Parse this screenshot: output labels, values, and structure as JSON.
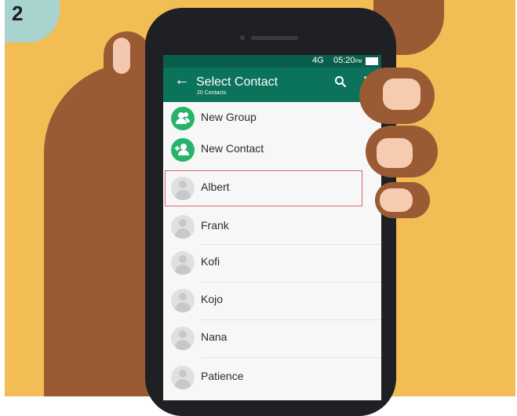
{
  "step_badge": "2",
  "status_bar": {
    "network": "4G",
    "time": "05:20",
    "time_suffix": "PM"
  },
  "app_bar": {
    "title": "Select Contact",
    "subtitle": "20 Contacts",
    "back_icon": "back-arrow-icon",
    "search_icon": "search-icon",
    "more_icon": "more-vert-icon"
  },
  "actions": [
    {
      "label": "New Group",
      "icon": "group-icon"
    },
    {
      "label": "New Contact",
      "icon": "add-contact-icon"
    }
  ],
  "contacts": [
    {
      "name": "Albert",
      "highlighted": true
    },
    {
      "name": "Frank"
    },
    {
      "name": "Kofi"
    },
    {
      "name": "Kojo"
    },
    {
      "name": "Nana"
    },
    {
      "name": "Patience"
    }
  ],
  "colors": {
    "background": "#f2bd55",
    "app_bar": "#0b725c",
    "status_bar": "#0b5e4c",
    "accent_green": "#26b36a",
    "highlight_border": "#d26a6a",
    "badge": "#a9d3cf",
    "skin": "#9a5a34"
  }
}
